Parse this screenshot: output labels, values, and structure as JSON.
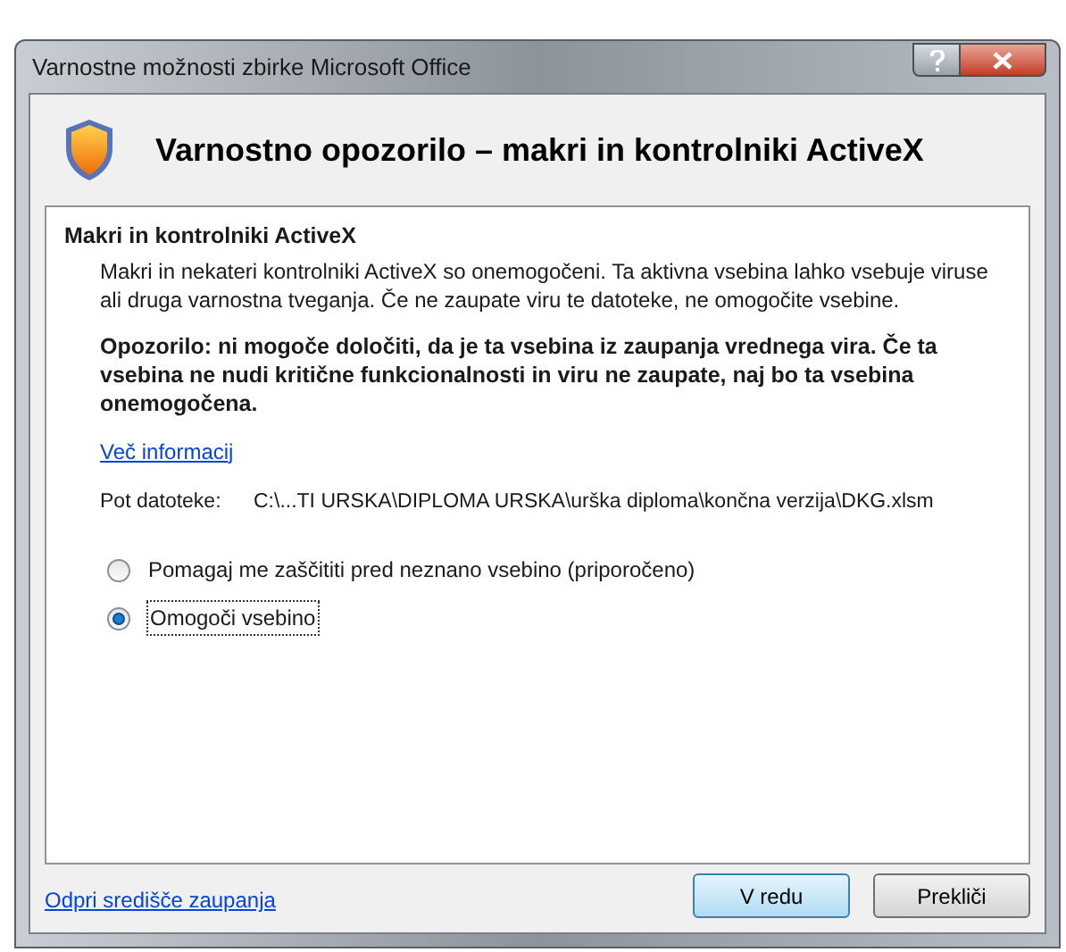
{
  "window": {
    "title": "Varnostne možnosti zbirke Microsoft Office"
  },
  "heading": "Varnostno opozorilo – makri in kontrolniki ActiveX",
  "section": {
    "title": "Makri in kontrolniki ActiveX",
    "description": "Makri in nekateri kontrolniki ActiveX so onemogočeni. Ta aktivna vsebina lahko vsebuje viruse ali druga varnostna tveganja. Če ne zaupate viru te datoteke, ne omogočite vsebine.",
    "warning": "Opozorilo: ni mogoče določiti, da je ta vsebina iz zaupanja vrednega vira. Če ta vsebina ne nudi kritične funkcionalnosti in viru ne zaupate, naj bo ta vsebina onemogočena.",
    "more_link": "Več informacij",
    "path_label": "Pot datoteke:",
    "path_value": "C:\\...TI URSKA\\DIPLOMA URSKA\\urška diploma\\končna verzija\\DKG.xlsm"
  },
  "options": [
    {
      "label": "Pomagaj me zaščititi pred neznano vsebino (priporočeno)",
      "selected": false
    },
    {
      "label": "Omogoči vsebino",
      "selected": true
    }
  ],
  "footer_link": "Odpri središče zaupanja",
  "buttons": [
    {
      "label": "V redu",
      "kind": "default"
    },
    {
      "label": "Prekliči",
      "kind": "normal"
    }
  ]
}
